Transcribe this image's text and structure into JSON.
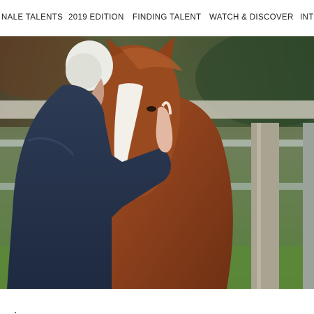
{
  "nav": {
    "items": [
      {
        "label": "NALE TALENTS"
      },
      {
        "label": "2019 EDITION"
      },
      {
        "label": "FINDING TALENT"
      },
      {
        "label": "WATCH & DISCOVER"
      },
      {
        "label": "INTI"
      }
    ]
  },
  "hero": {
    "image_subject": "man-hugging-horse-photo"
  },
  "colors": {
    "nav_text": "#222222",
    "background": "#ffffff"
  }
}
